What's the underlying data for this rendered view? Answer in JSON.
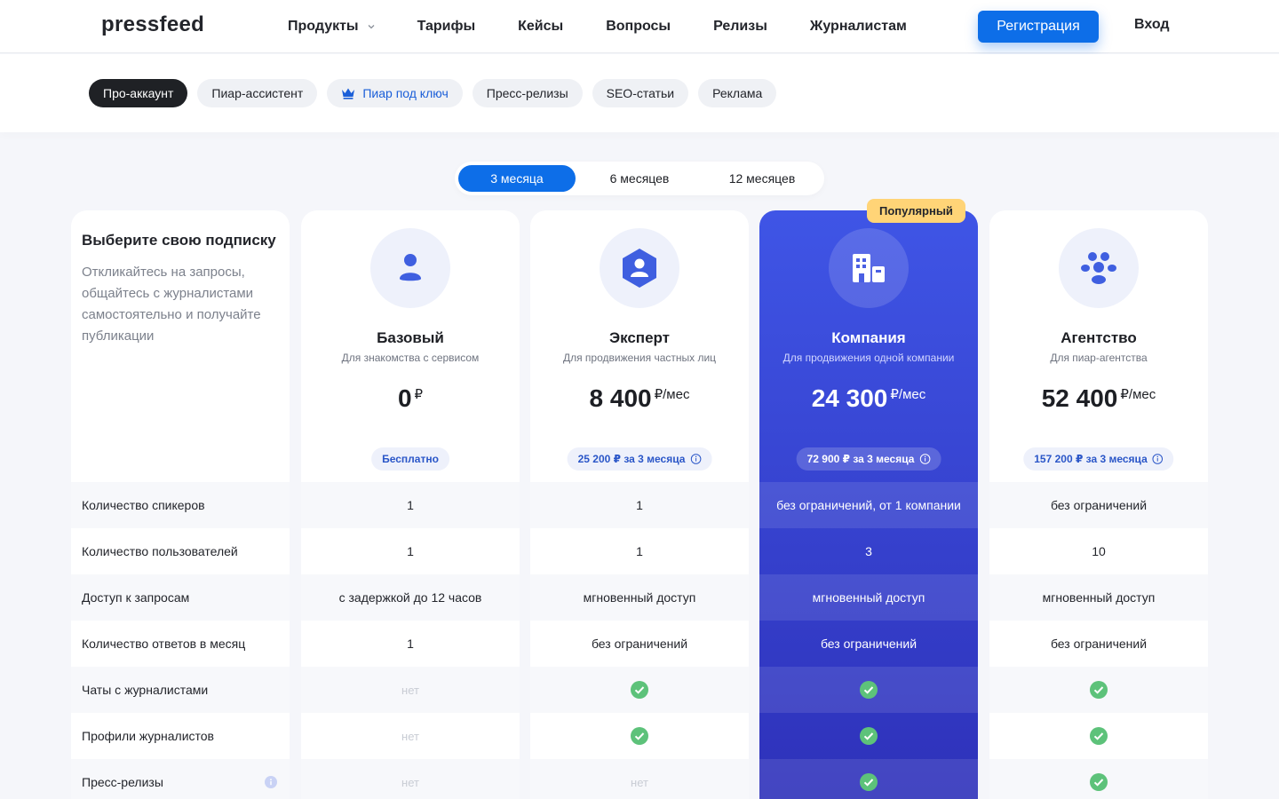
{
  "header": {
    "logo": "pressfeed",
    "nav": [
      "Продукты",
      "Тарифы",
      "Кейсы",
      "Вопросы",
      "Релизы",
      "Журналистам"
    ],
    "register": "Регистрация",
    "login": "Вход"
  },
  "product_tabs": [
    "Про-аккаунт",
    "Пиар-ассистент",
    "Пиар под ключ",
    "Пресс-релизы",
    "SEO-статьи",
    "Реклама"
  ],
  "period": [
    "3 месяца",
    "6 месяцев",
    "12 месяцев"
  ],
  "intro": {
    "title": "Выберите свою подписку",
    "desc": "Откликайтесь на запросы, общайтесь с журналистами самостоятельно и получайте публикации"
  },
  "features": [
    "Количество спикеров",
    "Количество пользователей",
    "Доступ к запросам",
    "Количество ответов в месяц",
    "Чаты с журналистами",
    "Профили журналистов",
    "Пресс-релизы"
  ],
  "plans": {
    "basic": {
      "name": "Базовый",
      "sub": "Для знакомства с сервисом",
      "price": "0",
      "currency": "₽",
      "badge": "Бесплатно",
      "values": [
        "1",
        "1",
        "с задержкой до 12 часов",
        "1",
        "нет",
        "нет",
        "нет"
      ]
    },
    "expert": {
      "name": "Эксперт",
      "sub": "Для продвижения частных лиц",
      "price": "8 400",
      "unit": "₽/мес",
      "badge": "25 200 ₽ за 3 месяца",
      "values": [
        "1",
        "1",
        "мгновенный доступ",
        "без ограничений",
        "check",
        "check",
        "нет"
      ]
    },
    "company": {
      "name": "Компания",
      "sub": "Для продвижения одной компании",
      "price": "24 300",
      "unit": "₽/мес",
      "badge": "72 900 ₽ за 3 месяца",
      "popular": "Популярный",
      "values": [
        "без ограничений, от 1 компании",
        "3",
        "мгновенный доступ",
        "без ограничений",
        "check",
        "check",
        "check"
      ]
    },
    "agency": {
      "name": "Агентство",
      "sub": "Для пиар-агентства",
      "price": "52 400",
      "unit": "₽/мес",
      "badge": "157 200 ₽ за 3 месяца",
      "values": [
        "без ограничений",
        "10",
        "мгновенный доступ",
        "без ограничений",
        "check",
        "check",
        "check"
      ]
    }
  },
  "colors": {
    "accent": "#0d6ee8",
    "popular_bg": "#ffd477",
    "check": "#5dc27a"
  }
}
